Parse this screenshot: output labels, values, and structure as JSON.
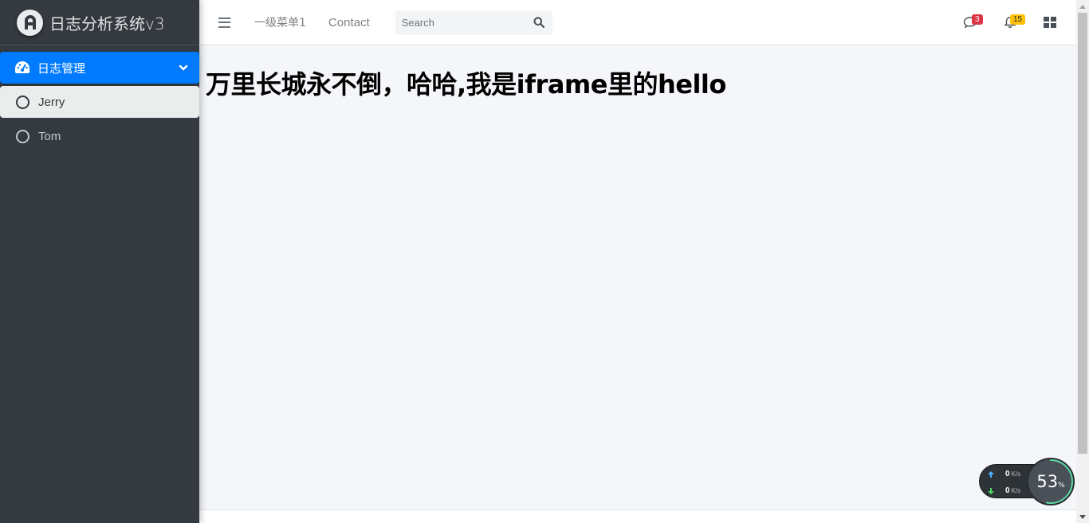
{
  "brand": {
    "title": "日志分析系统v3"
  },
  "sidebar": {
    "menu": {
      "label": "日志管理"
    },
    "items": [
      {
        "label": "Jerry",
        "selected": true
      },
      {
        "label": "Tom",
        "selected": false
      }
    ]
  },
  "navbar": {
    "links": [
      "一级菜单1",
      "Contact"
    ],
    "search_placeholder": "Search",
    "messages_count": "3",
    "notifications_count": "15"
  },
  "content": {
    "heading": "万里长城永不倒，哈哈,我是iframe里的hello"
  },
  "netmonitor": {
    "upload": "0",
    "download": "0",
    "unit": "K/s",
    "percent": "53",
    "percent_sign": "%"
  },
  "colors": {
    "sidebar_bg": "#343a40",
    "accent": "#007bff",
    "badge_red": "#dc3545",
    "badge_yellow": "#ffc107",
    "upload_arrow": "#4fb3ff",
    "download_arrow": "#4cd964"
  }
}
